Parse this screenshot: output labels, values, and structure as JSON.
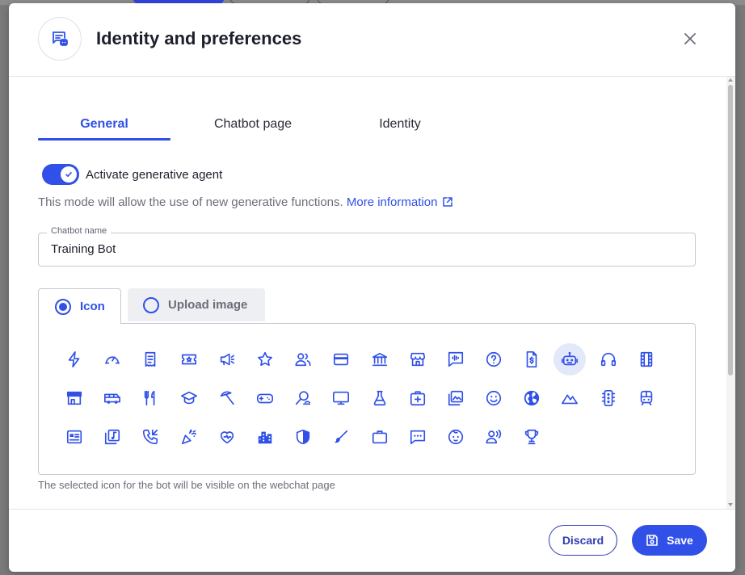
{
  "backdrop": {
    "colors": {
      "overlay": "#7a7a7a"
    }
  },
  "modal": {
    "title": "Identity and preferences",
    "header_icon": "chat-bot-icon",
    "close_icon": "close-icon"
  },
  "tabs": [
    {
      "label": "General",
      "active": true
    },
    {
      "label": "Chatbot page",
      "active": false
    },
    {
      "label": "Identity",
      "active": false
    }
  ],
  "generative": {
    "toggle_label": "Activate generative agent",
    "enabled": true,
    "description": "This mode will allow the use of new generative functions.",
    "link_label": "More information"
  },
  "chatbot_name": {
    "label": "Chatbot name",
    "value": "Training Bot"
  },
  "image_source": {
    "options": [
      {
        "label": "Icon",
        "selected": true
      },
      {
        "label": "Upload image",
        "selected": false
      }
    ]
  },
  "icons": {
    "items": [
      "flash-icon",
      "speedometer-icon",
      "receipt-icon",
      "ticket-icon",
      "megaphone-icon",
      "star-icon",
      "people-icon",
      "credit-card-icon",
      "bank-icon",
      "store-icon",
      "voice-message-icon",
      "help-circle-icon",
      "invoice-icon",
      "robot-icon",
      "headphones-icon",
      "film-icon",
      "shop-icon",
      "bus-icon",
      "restaurant-icon",
      "graduation-cap-icon",
      "umbrella-icon",
      "gamepad-icon",
      "search-person-icon",
      "monitor-icon",
      "flask-icon",
      "first-aid-icon",
      "photo-library-icon",
      "smile-icon",
      "globe-icon",
      "mountain-icon",
      "traffic-light-icon",
      "train-icon",
      "news-icon",
      "music-library-icon",
      "phone-callback-icon",
      "celebration-icon",
      "heart-icon",
      "city-icon",
      "shield-icon",
      "brush-icon",
      "briefcase-icon",
      "chat-icon",
      "baby-face-icon",
      "voice-person-icon",
      "trophy-icon"
    ],
    "selected": "robot-icon",
    "note": "The selected icon for the bot will be visible on the webchat page"
  },
  "footer": {
    "discard_label": "Discard",
    "save_label": "Save"
  },
  "colors": {
    "accent": "#3050e8",
    "text": "#1d1f2b",
    "muted": "#6b6e7a"
  }
}
